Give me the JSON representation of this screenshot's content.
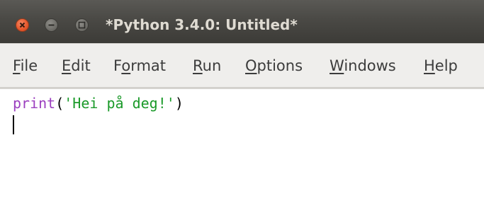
{
  "window": {
    "title": "*Python 3.4.0: Untitled*"
  },
  "titlebar_buttons": {
    "close": "close-icon",
    "minimize": "minimize-icon",
    "maximize": "maximize-icon"
  },
  "menu": {
    "items": [
      {
        "label_first": "F",
        "label_rest": "ile"
      },
      {
        "label_first": "E",
        "label_rest": "dit"
      },
      {
        "label_before": "F",
        "label_u": "o",
        "label_rest": "rmat"
      },
      {
        "label_first": "R",
        "label_rest": "un"
      },
      {
        "label_first": "O",
        "label_rest": "ptions"
      },
      {
        "label_first": "W",
        "label_rest": "indows"
      },
      {
        "label_first": "H",
        "label_rest": "elp"
      }
    ]
  },
  "editor": {
    "line1": {
      "keyword": "print",
      "open_paren": "(",
      "string": "'Hei på deg!'",
      "close_paren": ")"
    }
  },
  "colors": {
    "keyword": "#9b3fbf",
    "string": "#1b9a2a",
    "titlebar": "#3c3b37",
    "close_button": "#e8592d"
  }
}
